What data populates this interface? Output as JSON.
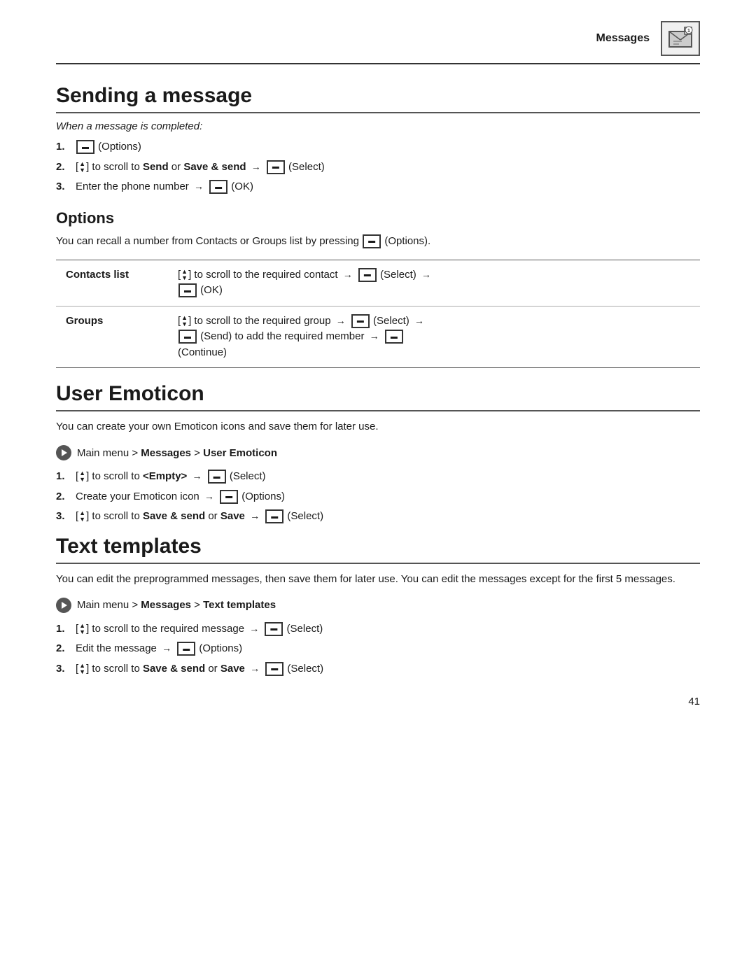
{
  "header": {
    "title": "Messages",
    "icon_label": "messages-icon"
  },
  "section1": {
    "title": "Sending a message",
    "subtitle": "When a message is completed:",
    "steps": [
      {
        "number": "1.",
        "content": "(Options)"
      },
      {
        "number": "2.",
        "content_parts": [
          "[▲/▼] to scroll to ",
          "Send",
          " or ",
          "Save & send",
          " → ",
          " (Select)"
        ]
      },
      {
        "number": "3.",
        "content_parts": [
          "Enter the phone number → ",
          " (OK)"
        ]
      }
    ],
    "options": {
      "title": "Options",
      "paragraph": "You can recall a number from Contacts or Groups list by pressing\n (Options).",
      "table": {
        "rows": [
          {
            "label": "Contacts list",
            "content": "[▲/▼] to scroll to the required contact → [  ] (Select) → [  ] (OK)"
          },
          {
            "label": "Groups",
            "content": "[▲/▼] to scroll to the required group → [  ] (Select) → [  ] (Send) to add the required member → [  ] (Continue)"
          }
        ]
      }
    }
  },
  "section2": {
    "title": "User Emoticon",
    "paragraph": "You can create your own Emoticon icons and save them for later use.",
    "menu_path": "Main menu > Messages > User Emoticon",
    "steps": [
      {
        "number": "1.",
        "content": "[▲/▼] to scroll to <Empty> → [  ] (Select)"
      },
      {
        "number": "2.",
        "content": "Create your Emoticon icon → [  ] (Options)"
      },
      {
        "number": "3.",
        "content": "[▲/▼] to scroll to Save & send or Save → [  ] (Select)"
      }
    ]
  },
  "section3": {
    "title": "Text templates",
    "paragraph": "You can edit the preprogrammed messages, then save them for later use. You can edit the messages except for the first 5 messages.",
    "menu_path": "Main menu > Messages > Text templates",
    "steps": [
      {
        "number": "1.",
        "content": "[▲/▼] to scroll to the required message → [  ] (Select)"
      },
      {
        "number": "2.",
        "content": "Edit the message → [  ] (Options)"
      },
      {
        "number": "3.",
        "content": "[▲/▼] to scroll to Save & send or Save → [  ] (Select)"
      }
    ]
  },
  "page_number": "41"
}
